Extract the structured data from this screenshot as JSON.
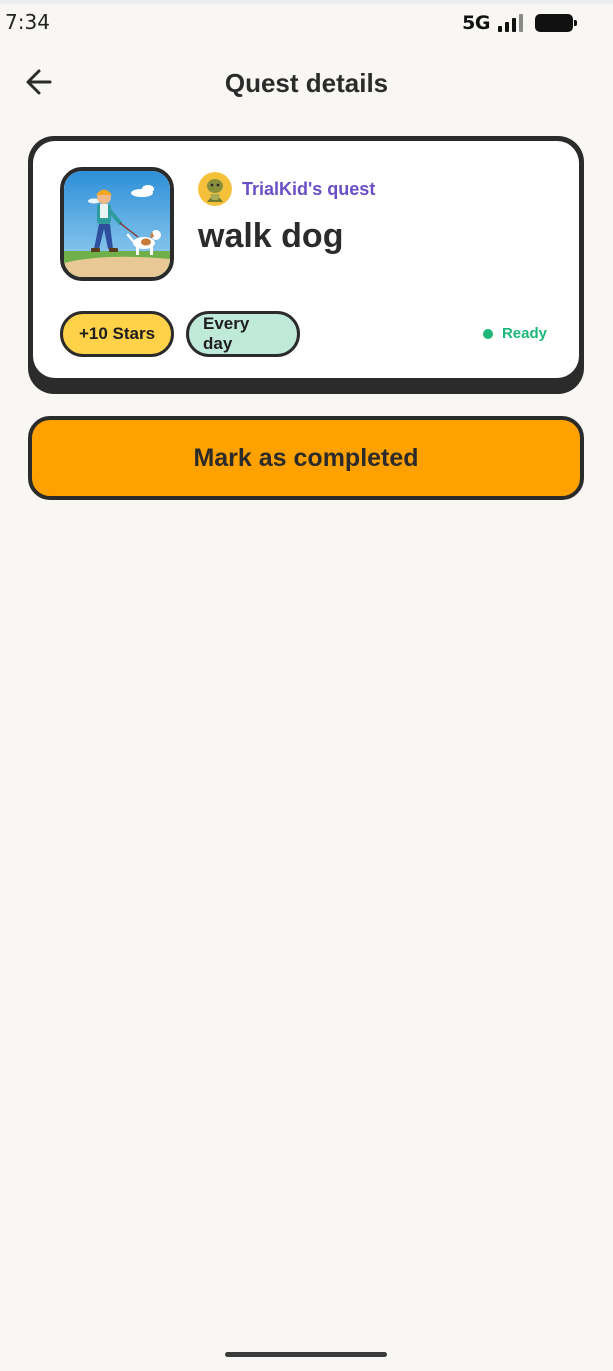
{
  "status_bar": {
    "time": "7:34",
    "network": "5G",
    "icons": [
      "signal-icon",
      "battery-icon"
    ]
  },
  "header": {
    "title": "Quest details",
    "back_icon": "arrow-left-icon"
  },
  "quest": {
    "owner_label": "TrialKid's quest",
    "title": "walk dog",
    "reward": "+10 Stars",
    "frequency": "Every day",
    "status": "Ready",
    "status_color": "#1bb878"
  },
  "actions": {
    "complete_label": "Mark as completed"
  },
  "colors": {
    "accent": "#ffa200",
    "owner_text": "#6a4fc7",
    "reward_chip": "#ffd24a",
    "frequency_chip": "#bfe9d8",
    "outline": "#2b2b2b",
    "background": "#f8f7f4"
  }
}
